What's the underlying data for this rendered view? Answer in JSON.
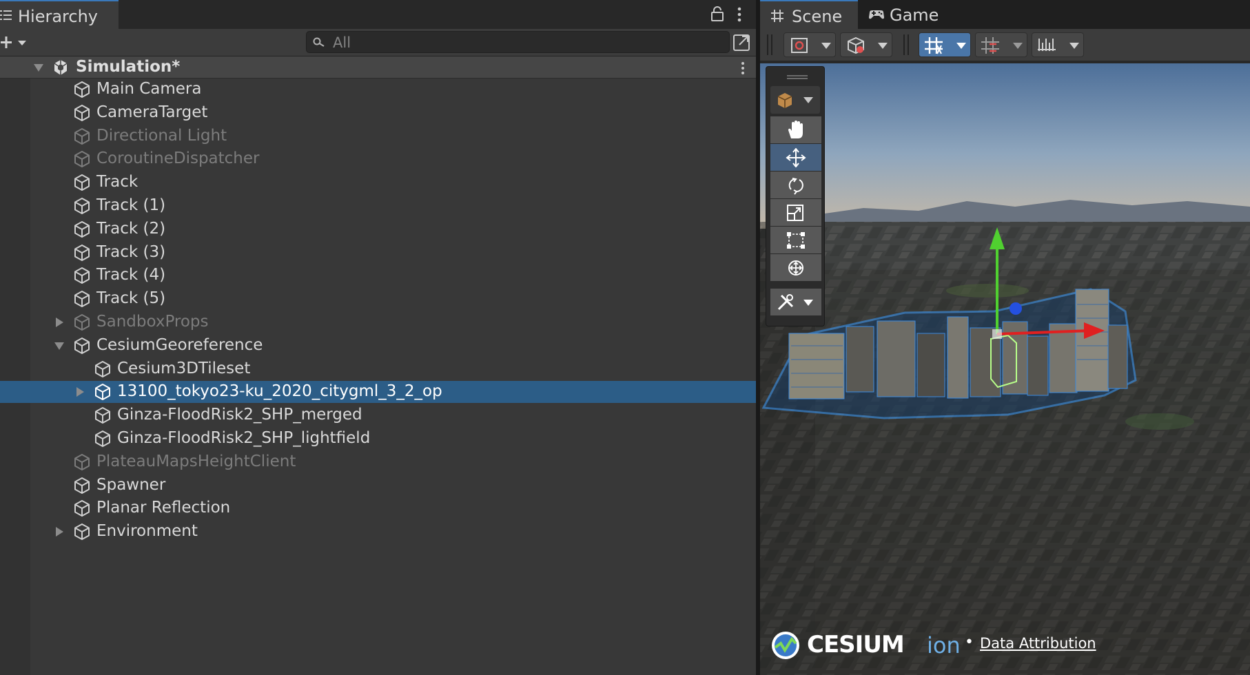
{
  "hierarchy": {
    "tab_label": "Hierarchy",
    "search_placeholder": "All",
    "scene_name": "Simulation*",
    "rows": [
      {
        "label": "Main Camera",
        "state": "normal"
      },
      {
        "label": "CameraTarget",
        "state": "normal"
      },
      {
        "label": "Directional Light",
        "state": "disabled"
      },
      {
        "label": "CoroutineDispatcher",
        "state": "disabled"
      },
      {
        "label": "Track",
        "state": "normal"
      },
      {
        "label": "Track (1)",
        "state": "normal"
      },
      {
        "label": "Track (2)",
        "state": "normal"
      },
      {
        "label": "Track (3)",
        "state": "normal"
      },
      {
        "label": "Track (4)",
        "state": "normal"
      },
      {
        "label": "Track (5)",
        "state": "normal"
      },
      {
        "label": "SandboxProps",
        "state": "disabled",
        "expander": "collapsed"
      },
      {
        "label": "CesiumGeoreference",
        "state": "normal",
        "expander": "expanded"
      },
      {
        "label": "Cesium3DTileset",
        "state": "normal"
      },
      {
        "label": "13100_tokyo23-ku_2020_citygml_3_2_op",
        "state": "selected",
        "expander": "collapsed"
      },
      {
        "label": "Ginza-FloodRisk2_SHP_merged",
        "state": "normal"
      },
      {
        "label": "Ginza-FloodRisk2_SHP_lightfield",
        "state": "normal"
      },
      {
        "label": "PlateauMapsHeightClient",
        "state": "disabled"
      },
      {
        "label": "Spawner",
        "state": "normal"
      },
      {
        "label": "Planar Reflection",
        "state": "normal"
      },
      {
        "label": "Environment",
        "state": "normal",
        "expander": "collapsed"
      }
    ]
  },
  "scene_view": {
    "tabs": [
      {
        "label": "Scene",
        "icon": "grid-hash-icon",
        "active": true
      },
      {
        "label": "Game",
        "icon": "gamepad-icon",
        "active": false
      }
    ],
    "overlay_toolbar": [
      "view-options-icon",
      "draw-mode-icon",
      "grid-snapping-icon",
      "increment-snap-icon",
      "ruler-icon"
    ],
    "tools": [
      "hand-tool",
      "move-tool",
      "rotate-tool",
      "scale-tool",
      "rect-tool",
      "transform-tool",
      "custom-editor-tool"
    ],
    "active_tool": "move-tool",
    "credit": {
      "logo_word": "CESIUM",
      "logo_suffix": "ion",
      "separator": "•",
      "link": "Data Attribution"
    }
  },
  "colors": {
    "selection": "#2c5d87",
    "accent": "#3a79bb",
    "gizmo_x": "#e02020",
    "gizmo_y": "#50d030",
    "gizmo_z": "#2450e0"
  }
}
